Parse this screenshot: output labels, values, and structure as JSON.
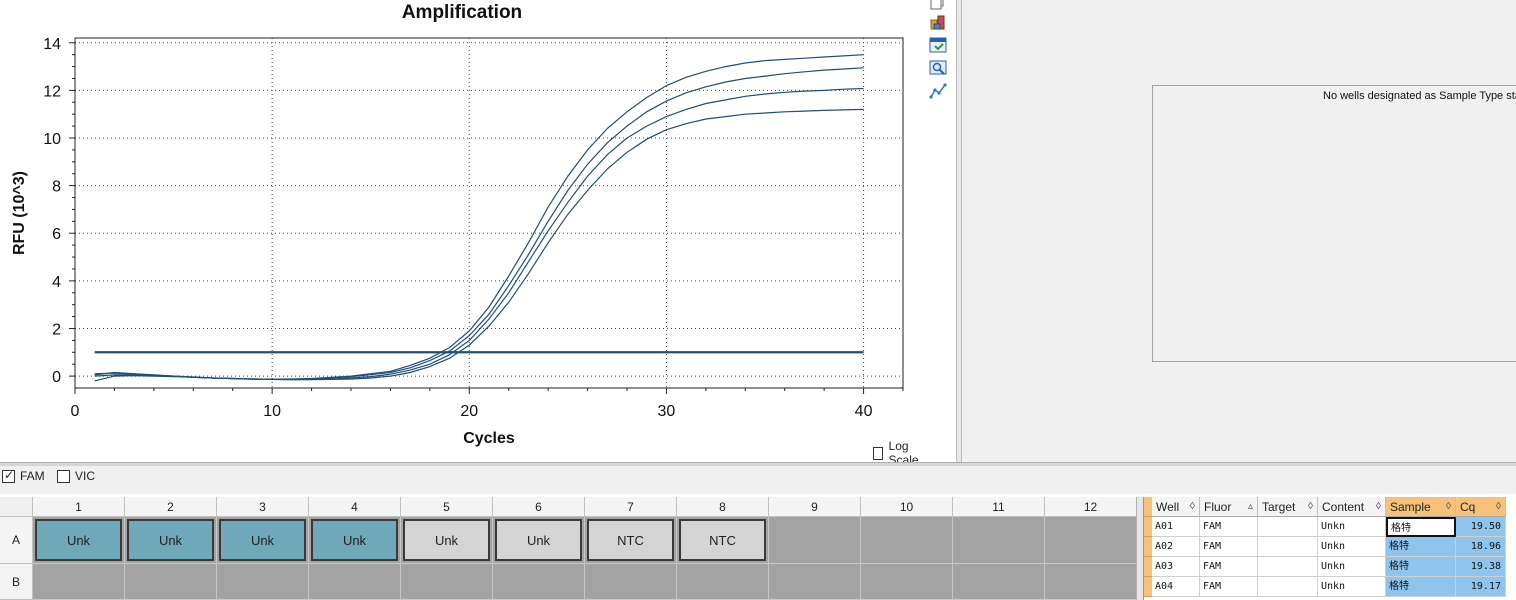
{
  "chart_data": {
    "type": "line",
    "title": "Amplification",
    "xlabel": "Cycles",
    "ylabel": "RFU (10^3)",
    "xlim": [
      0,
      42
    ],
    "ylim": [
      -0.5,
      14.2
    ],
    "x_ticks": [
      0,
      10,
      20,
      30,
      40
    ],
    "y_ticks": [
      0,
      2,
      4,
      6,
      8,
      10,
      12,
      14
    ],
    "grid": true,
    "threshold": 1.0,
    "series_color": "#1f4e79",
    "series": [
      {
        "x": [
          1,
          2,
          3,
          4,
          5,
          6,
          7,
          8,
          9,
          10,
          11,
          12,
          13,
          14,
          15,
          16,
          17,
          18,
          19,
          20,
          21,
          22,
          23,
          24,
          25,
          26,
          27,
          28,
          29,
          30,
          31,
          32,
          33,
          34,
          35,
          36,
          37,
          38,
          39,
          40
        ],
        "values": [
          0.05,
          0.15,
          0.1,
          0.05,
          0.0,
          -0.05,
          -0.08,
          -0.1,
          -0.12,
          -0.13,
          -0.12,
          -0.1,
          -0.05,
          0.0,
          0.1,
          0.2,
          0.45,
          0.75,
          1.2,
          1.9,
          2.9,
          4.2,
          5.6,
          7.1,
          8.4,
          9.5,
          10.4,
          11.1,
          11.7,
          12.2,
          12.55,
          12.8,
          13.0,
          13.15,
          13.25,
          13.3,
          13.35,
          13.4,
          13.45,
          13.5
        ]
      },
      {
        "x": [
          1,
          2,
          3,
          4,
          5,
          6,
          7,
          8,
          9,
          10,
          11,
          12,
          13,
          14,
          15,
          16,
          17,
          18,
          19,
          20,
          21,
          22,
          23,
          24,
          25,
          26,
          27,
          28,
          29,
          30,
          31,
          32,
          33,
          34,
          35,
          36,
          37,
          38,
          39,
          40
        ],
        "values": [
          0.0,
          0.05,
          0.05,
          0.02,
          0.0,
          -0.04,
          -0.08,
          -0.1,
          -0.12,
          -0.13,
          -0.13,
          -0.12,
          -0.08,
          -0.02,
          0.06,
          0.15,
          0.35,
          0.65,
          1.05,
          1.7,
          2.6,
          3.8,
          5.1,
          6.5,
          7.8,
          8.9,
          9.8,
          10.5,
          11.1,
          11.55,
          11.9,
          12.15,
          12.35,
          12.5,
          12.6,
          12.7,
          12.78,
          12.85,
          12.9,
          12.95
        ]
      },
      {
        "x": [
          1,
          2,
          3,
          4,
          5,
          6,
          7,
          8,
          9,
          10,
          11,
          12,
          13,
          14,
          15,
          16,
          17,
          18,
          19,
          20,
          21,
          22,
          23,
          24,
          25,
          26,
          27,
          28,
          29,
          30,
          31,
          32,
          33,
          34,
          35,
          36,
          37,
          38,
          39,
          40
        ],
        "values": [
          0.1,
          0.12,
          0.08,
          0.04,
          0.0,
          -0.05,
          -0.08,
          -0.11,
          -0.13,
          -0.14,
          -0.15,
          -0.14,
          -0.12,
          -0.08,
          -0.02,
          0.08,
          0.25,
          0.5,
          0.9,
          1.5,
          2.4,
          3.5,
          4.8,
          6.1,
          7.3,
          8.4,
          9.3,
          10.0,
          10.5,
          10.9,
          11.2,
          11.45,
          11.6,
          11.75,
          11.85,
          11.92,
          11.97,
          12.0,
          12.05,
          12.08
        ]
      },
      {
        "x": [
          1,
          2,
          3,
          4,
          5,
          6,
          7,
          8,
          9,
          10,
          11,
          12,
          13,
          14,
          15,
          16,
          17,
          18,
          19,
          20,
          21,
          22,
          23,
          24,
          25,
          26,
          27,
          28,
          29,
          30,
          31,
          32,
          33,
          34,
          35,
          36,
          37,
          38,
          39,
          40
        ],
        "values": [
          -0.2,
          0.0,
          0.02,
          0.0,
          -0.02,
          -0.05,
          -0.08,
          -0.1,
          -0.12,
          -0.14,
          -0.15,
          -0.15,
          -0.14,
          -0.12,
          -0.08,
          0.0,
          0.15,
          0.4,
          0.75,
          1.3,
          2.1,
          3.1,
          4.3,
          5.6,
          6.8,
          7.8,
          8.7,
          9.4,
          9.95,
          10.35,
          10.6,
          10.8,
          10.9,
          11.0,
          11.05,
          11.1,
          11.13,
          11.16,
          11.18,
          11.2
        ]
      }
    ]
  },
  "log_scale_label": "Log Scale",
  "toolbar": {
    "icons": [
      "copy-icon",
      "export-icon",
      "chart-settings-icon",
      "zoom-icon",
      "line-style-icon"
    ]
  },
  "std_curve_message": "No wells designated as Sample Type stan",
  "fluors": [
    {
      "label": "FAM",
      "checked": true
    },
    {
      "label": "VIC",
      "checked": false
    }
  ],
  "plate": {
    "columns": [
      "1",
      "2",
      "3",
      "4",
      "5",
      "6",
      "7",
      "8",
      "9",
      "10",
      "11",
      "12"
    ],
    "rows": [
      "A",
      "B"
    ],
    "wells_A": [
      "Unk",
      "Unk",
      "Unk",
      "Unk",
      "Unk",
      "Unk",
      "NTC",
      "NTC",
      "",
      "",
      "",
      ""
    ],
    "well_colors": {
      "selected": "#6fa8b8",
      "unselected": "#d4d4d4",
      "empty": "#a3a3a3"
    }
  },
  "results": {
    "headers": [
      "Well",
      "Fluor",
      "Target",
      "Content",
      "Sample",
      "Cq"
    ],
    "rows": [
      [
        "A01",
        "FAM",
        "",
        "Unkn",
        "格特",
        "19.50"
      ],
      [
        "A02",
        "FAM",
        "",
        "Unkn",
        "格特",
        "18.96"
      ],
      [
        "A03",
        "FAM",
        "",
        "Unkn",
        "格特",
        "19.38"
      ],
      [
        "A04",
        "FAM",
        "",
        "Unkn",
        "格特",
        "19.17"
      ]
    ]
  }
}
